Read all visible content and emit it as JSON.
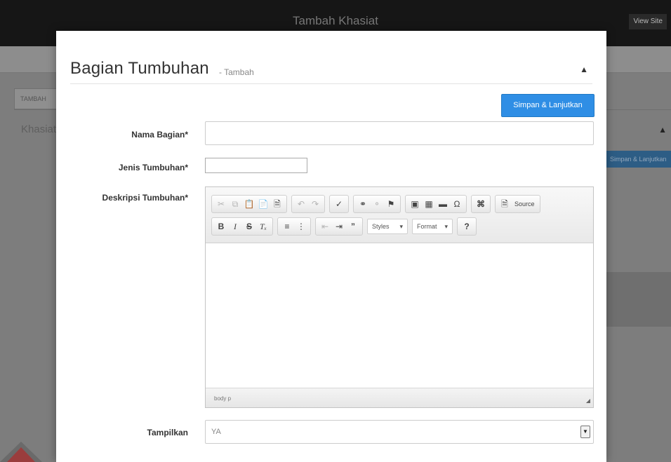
{
  "background": {
    "app_title": "Tambah Khasiat",
    "view_site_label": "View Site",
    "tab_label": "TAMBAH",
    "section_title": "Khasiat",
    "save_button_label": "Simpan & Lanjutkan",
    "collapse_icon": "chevron-up-icon"
  },
  "modal": {
    "title": "Bagian Tumbuhan",
    "subtitle": "- Tambah",
    "collapse_icon": "chevron-up-icon",
    "save_button_label": "Simpan & Lanjutkan",
    "fields": {
      "nama_bagian": {
        "label": "Nama Bagian*",
        "value": ""
      },
      "jenis_tumbuhan": {
        "label": "Jenis Tumbuhan*",
        "value": ""
      },
      "deskripsi": {
        "label": "Deskripsi Tumbuhan*"
      },
      "tampilkan": {
        "label": "Tampilkan",
        "selected": "YA"
      }
    },
    "editor": {
      "toolbar_row1": [
        [
          "cut-icon",
          "copy-icon",
          "paste-icon",
          "paste-text-icon",
          "paste-word-icon"
        ],
        [
          "undo-icon",
          "redo-icon"
        ],
        [
          "spellcheck-icon"
        ],
        [
          "link-icon",
          "unlink-icon",
          "anchor-icon"
        ],
        [
          "image-icon",
          "table-icon",
          "horizontal-rule-icon",
          "special-char-icon"
        ],
        [
          "maximize-icon"
        ],
        [
          "source-icon"
        ]
      ],
      "source_label": "Source",
      "toolbar_row2": [
        [
          "bold-icon",
          "italic-icon",
          "strike-icon",
          "remove-format-icon"
        ],
        [
          "numbered-list-icon",
          "bulleted-list-icon"
        ],
        [
          "outdent-icon",
          "indent-icon",
          "blockquote-icon"
        ]
      ],
      "styles_label": "Styles",
      "format_label": "Format",
      "help_label": "?",
      "status_path": "body  p"
    }
  },
  "colors": {
    "primary_button": "#2f8ee5",
    "overlay_dark": "#161616"
  }
}
